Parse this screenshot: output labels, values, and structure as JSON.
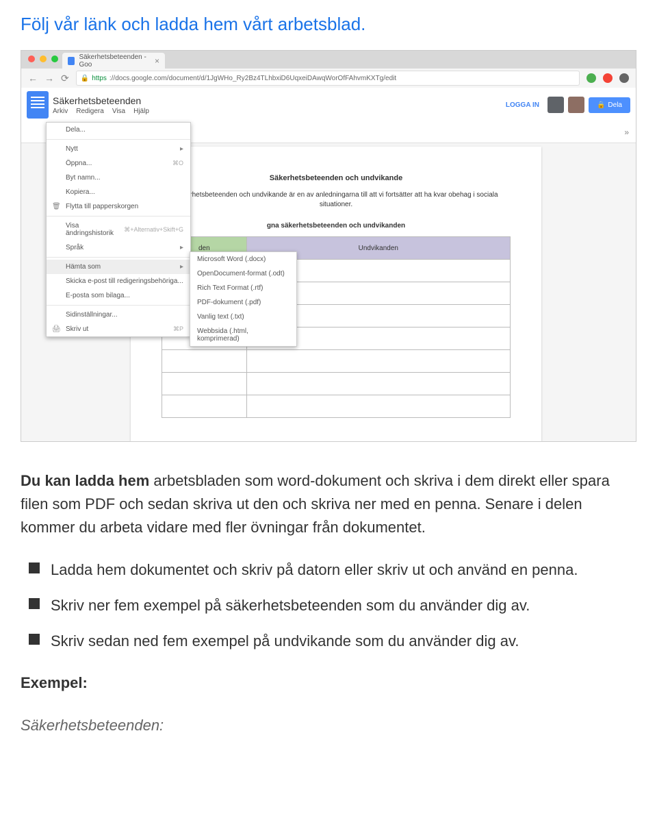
{
  "heading_link": "Följ vår länk och ladda hem vårt arbetsblad.",
  "browser": {
    "tab_title": "Säkerhetsbeteenden - Goo",
    "url_prefix": "https",
    "url_rest": "://docs.google.com/document/d/1JgWHo_Ry2Bz4TLhbxiD6UqxeiDAwqWorOfFAhvmKXTg/edit"
  },
  "docs": {
    "title": "Säkerhetsbeteenden",
    "menu": [
      "Arkiv",
      "Redigera",
      "Visa",
      "Hjälp"
    ],
    "login": "LOGGA IN",
    "share": "Dela"
  },
  "file_menu": {
    "items": [
      {
        "label": "Dela..."
      },
      {
        "sep": true
      },
      {
        "label": "Nytt",
        "arrow": true
      },
      {
        "label": "Öppna...",
        "shortcut": "⌘O"
      },
      {
        "label": "Byt namn..."
      },
      {
        "label": "Kopiera..."
      },
      {
        "label": "Flytta till papperskorgen",
        "icon": "🗑"
      },
      {
        "sep": true
      },
      {
        "label": "Visa ändringshistorik",
        "shortcut": "⌘+Alternativ+Skift+G"
      },
      {
        "label": "Språk",
        "arrow": true
      },
      {
        "sep": true
      },
      {
        "label": "Hämta som",
        "arrow": true,
        "hl": true
      },
      {
        "label": "Skicka e-post till redigeringsbehöriga..."
      },
      {
        "label": "E-posta som bilaga..."
      },
      {
        "sep": true
      },
      {
        "label": "Sidinställningar..."
      },
      {
        "label": "Skriv ut",
        "shortcut": "⌘P",
        "icon": "🖨"
      }
    ]
  },
  "submenu": [
    "Microsoft Word (.docx)",
    "OpenDocument-format (.odt)",
    "Rich Text Format (.rtf)",
    "PDF-dokument (.pdf)",
    "Vanlig text (.txt)",
    "Webbsida (.html, komprimerad)"
  ],
  "paper": {
    "h": "Säkerhetsbeteenden och undvikande",
    "intro": "Säkerhetsbeteenden och undvikande är en av anledningarna till att vi fortsätter att ha kvar obehag i sociala situationer.",
    "sub_heading_suffix": "gna säkerhetsbeteenden och undvikanden",
    "th1_suffix": "den",
    "th2": "Undvikanden"
  },
  "body1_rich": {
    "bold": "Du kan ladda hem",
    "rest": " arbetsbladen som word-dokument och skriva i dem direkt eller spara filen som PDF och sedan skriva ut den och skriva ner med en penna. Senare i delen kommer du arbeta vidare med fler övningar från dokumentet."
  },
  "list_items": [
    "Ladda hem dokumentet och skriv på datorn eller skriv ut och använd en penna.",
    "Skriv ner fem exempel på säkerhetsbeteenden som du använder dig av.",
    "Skriv sedan ned fem exempel på undvikande som du använder dig av."
  ],
  "exempel": "Exempel:",
  "italic": "Säkerhetsbeteenden:"
}
